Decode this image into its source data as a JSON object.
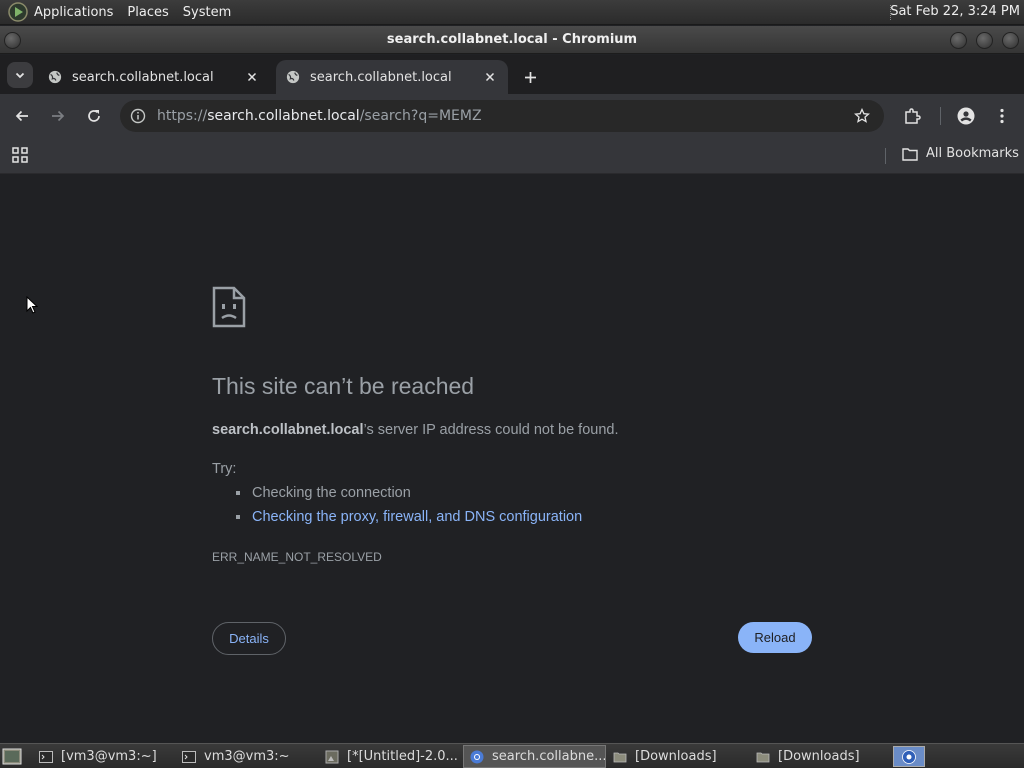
{
  "top_panel": {
    "menus": [
      "Applications",
      "Places",
      "System"
    ],
    "clock": "Sat Feb 22,  3:24 PM"
  },
  "window": {
    "title": "search.collabnet.local - Chromium"
  },
  "tabs": [
    {
      "label": "search.collabnet.local",
      "active": false
    },
    {
      "label": "search.collabnet.local",
      "active": true
    }
  ],
  "toolbar": {
    "url_scheme": "https://",
    "url_host": "search.collabnet.local",
    "url_path": "/search?q=MEMZ"
  },
  "bookmarks": {
    "all_label": "All Bookmarks"
  },
  "error_page": {
    "title": "This site can’t be reached",
    "host": "search.collabnet.local",
    "desc_rest": "’s server IP address could not be found.",
    "try_label": "Try:",
    "suggestions": [
      "Checking the connection",
      "Checking the proxy, firewall, and DNS configuration"
    ],
    "error_code": "ERR_NAME_NOT_RESOLVED",
    "details_label": "Details",
    "reload_label": "Reload"
  },
  "taskbar": {
    "items": [
      {
        "label": "[vm3@vm3:~]",
        "icon": "terminal-icon"
      },
      {
        "label": "vm3@vm3:~",
        "icon": "terminal-icon"
      },
      {
        "label": "[*[Untitled]-2.0...",
        "icon": "image-editor-icon"
      },
      {
        "label": "search.collabne...",
        "icon": "chromium-icon"
      },
      {
        "label": "[Downloads]",
        "icon": "folder-icon"
      },
      {
        "label": "[Downloads]",
        "icon": "folder-icon"
      }
    ]
  },
  "colors": {
    "page_bg": "#202124",
    "link": "#8ab4f8",
    "muted_text": "#9aa0a6",
    "reload_bg": "#8ab4f8"
  }
}
